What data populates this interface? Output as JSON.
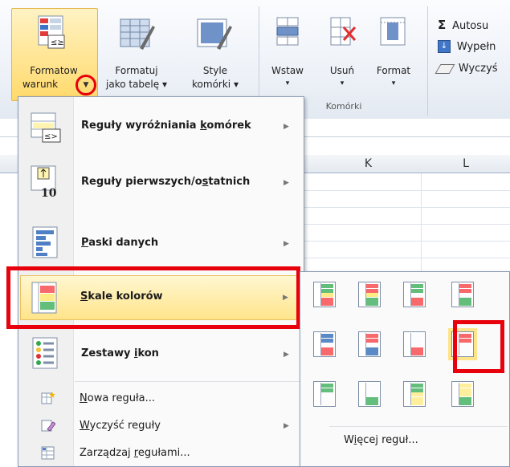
{
  "ribbon": {
    "buttons": [
      {
        "line1": "Formatow",
        "line2": "warunk"
      },
      {
        "line1": "Formatuj",
        "line2": "jako tabelę ▾"
      },
      {
        "line1": "Style",
        "line2": "komórki ▾"
      },
      {
        "line1": "Wstaw",
        "line2": "▾"
      },
      {
        "line1": "Usuń",
        "line2": "▾"
      },
      {
        "line1": "Format",
        "line2": "▾"
      }
    ],
    "cells_group_label": "Komórki",
    "edit_items": [
      {
        "icon": "sigma-icon",
        "label": "Autosu"
      },
      {
        "icon": "fill-down-icon",
        "label": "Wypełn"
      },
      {
        "icon": "eraser-icon",
        "label": "Wyczyś"
      }
    ],
    "sigma": "Σ"
  },
  "sheet": {
    "columns": [
      "K",
      "L"
    ]
  },
  "menu": {
    "items": [
      {
        "pre": "Reguły wyróżniania ",
        "u": "k",
        "post": "omórek",
        "arrow": "▶"
      },
      {
        "pre": "Reguły pierwszych/o",
        "u": "s",
        "post": "tatnich",
        "arrow": "▶"
      },
      {
        "pre": "",
        "u": "P",
        "post": "aski danych",
        "arrow": "▶"
      },
      {
        "pre": "",
        "u": "S",
        "post": "kale kolorów",
        "arrow": "▶"
      },
      {
        "pre": "Zestawy ",
        "u": "i",
        "post": "kon",
        "arrow": "▶"
      }
    ],
    "small_items": [
      {
        "pre": "",
        "u": "N",
        "post": "owa reguła..."
      },
      {
        "pre": "",
        "u": "W",
        "post": "yczyść reguły",
        "arrow": "▶"
      },
      {
        "pre": "Zarządzaj ",
        "u": "r",
        "post": "egułami..."
      }
    ],
    "icon_text": {
      "le": "≤>",
      "ten": "10"
    }
  },
  "submenu": {
    "more_pre": "W",
    "more_u": "i",
    "more_post": "ęcej reguł...",
    "scales": [
      [
        "#63be7b",
        "#ffeb84",
        "#f8696b"
      ],
      [
        "#f8696b",
        "#ffeb84",
        "#63be7b"
      ],
      [
        "#63be7b",
        "#fcfcff",
        "#f8696b"
      ],
      [
        "#f8696b",
        "#fcfcff",
        "#63be7b"
      ],
      [
        "#5a8ac6",
        "#fcfcff",
        "#f8696b"
      ],
      [
        "#f8696b",
        "#fcfcff",
        "#5a8ac6"
      ],
      [
        "#fcfcff",
        "#fcfcff",
        "#f8696b"
      ],
      [
        "#f8696b",
        "#fcfcff",
        "#fcfcff"
      ],
      [
        "#63be7b",
        "#fcfcff",
        "#fcfcff"
      ],
      [
        "#fcfcff",
        "#fcfcff",
        "#63be7b"
      ],
      [
        "#63be7b",
        "#ffef9c",
        "#ffef9c"
      ],
      [
        "#ffef9c",
        "#ffef9c",
        "#63be7b"
      ]
    ]
  }
}
